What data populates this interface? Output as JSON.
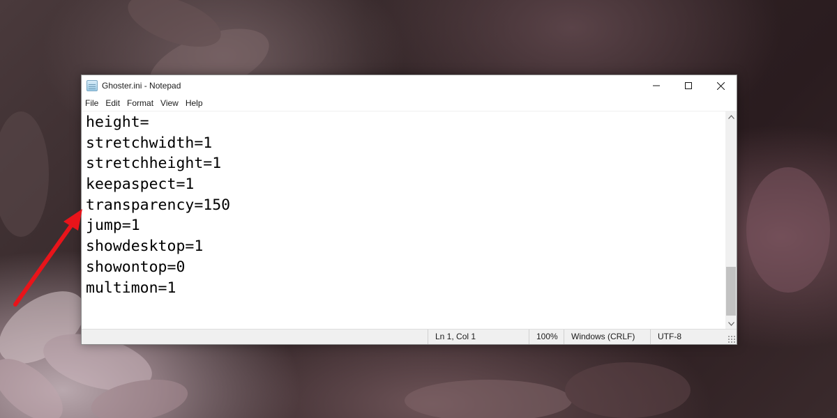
{
  "window": {
    "title": "Ghoster.ini - Notepad",
    "app_icon": "notepad-icon"
  },
  "caption_buttons": {
    "minimize": "─",
    "maximize": "☐",
    "close": "✕"
  },
  "menu": {
    "items": [
      "File",
      "Edit",
      "Format",
      "View",
      "Help"
    ]
  },
  "editor": {
    "lines": [
      "height=",
      "stretchwidth=1",
      "stretchheight=1",
      "keepaspect=1",
      "transparency=150",
      "jump=1",
      "showdesktop=1",
      "showontop=0",
      "multimon=1"
    ]
  },
  "scrollbar": {
    "up_icon": "chevron-up-icon",
    "down_icon": "chevron-down-icon"
  },
  "status": {
    "position": "Ln 1, Col 1",
    "zoom": "100%",
    "line_ending": "Windows (CRLF)",
    "encoding": "UTF-8"
  },
  "annotation": {
    "arrow_color": "#e8141a",
    "points_to": "transparency=150"
  },
  "colors": {
    "window_bg": "#ffffff",
    "statusbar_bg": "#f0f0f0",
    "arrow": "#e8141a"
  }
}
